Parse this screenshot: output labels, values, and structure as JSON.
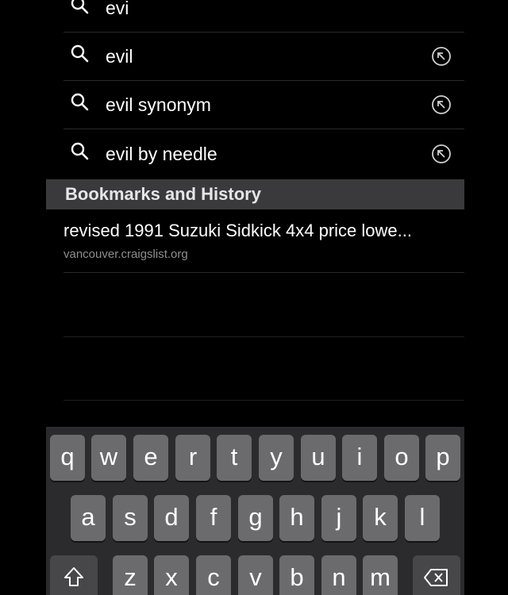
{
  "suggestions": [
    {
      "text": "evi",
      "icon": "search-icon",
      "fill_icon": null
    },
    {
      "text": "evil",
      "icon": "search-icon",
      "fill_icon": "arrow-up-left-icon"
    },
    {
      "text": "evil synonym",
      "icon": "search-icon",
      "fill_icon": "arrow-up-left-icon"
    },
    {
      "text": "evil by needle",
      "icon": "search-icon",
      "fill_icon": "arrow-up-left-icon"
    }
  ],
  "bookmarks_section": {
    "header": "Bookmarks and History",
    "items": [
      {
        "title": "revised 1991 Suzuki Sidkick 4x4 price lowe...",
        "url": "vancouver.craigslist.org"
      }
    ]
  },
  "keyboard": {
    "row1": [
      "q",
      "w",
      "e",
      "r",
      "t",
      "y",
      "u",
      "i",
      "o",
      "p"
    ],
    "row2": [
      "a",
      "s",
      "d",
      "f",
      "g",
      "h",
      "j",
      "k",
      "l"
    ],
    "row3": [
      "z",
      "x",
      "c",
      "v",
      "b",
      "n",
      "m"
    ],
    "shift_icon": "shift-icon",
    "delete_icon": "delete-icon"
  },
  "colors": {
    "background": "#000000",
    "section_header_bg": "#3a3a3c",
    "key_bg": "#6b6b6e",
    "keyboard_bg": "#2b2b2d",
    "url_text": "#8e8e93"
  }
}
